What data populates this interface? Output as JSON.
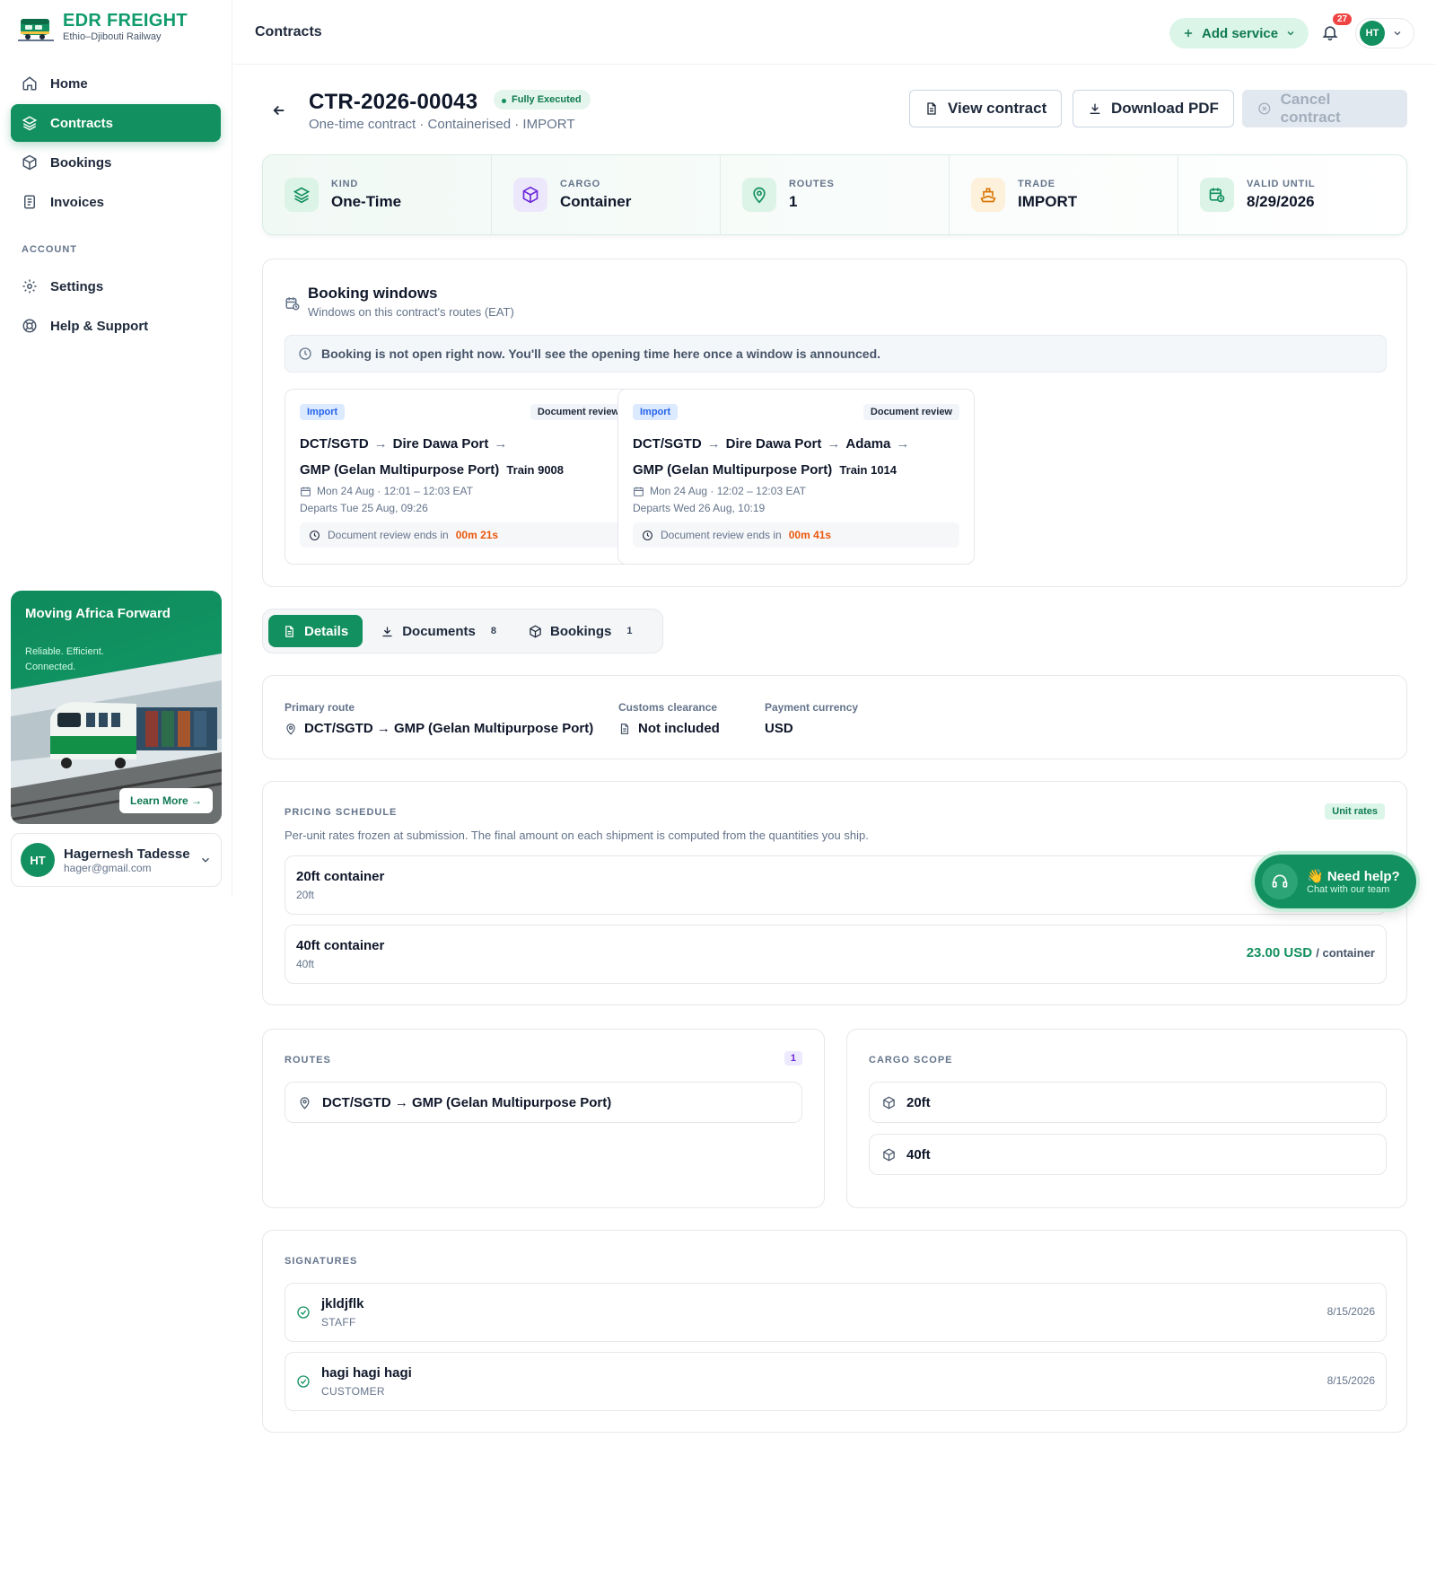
{
  "brand": {
    "title": "EDR FREIGHT",
    "subtitle": "Ethio–Djibouti Railway"
  },
  "sidebar": {
    "items": [
      {
        "label": "Home",
        "icon": "home-icon"
      },
      {
        "label": "Contracts",
        "icon": "layers-icon",
        "active": true
      },
      {
        "label": "Bookings",
        "icon": "package-icon"
      },
      {
        "label": "Invoices",
        "icon": "invoice-icon"
      }
    ],
    "account_label": "ACCOUNT",
    "account_items": [
      {
        "label": "Settings",
        "icon": "gear-icon"
      },
      {
        "label": "Help & Support",
        "icon": "lifebuoy-icon"
      }
    ],
    "promo": {
      "title": "Moving Africa Forward",
      "subtitle": "Reliable. Efficient. Connected.",
      "button": "Learn More →"
    },
    "user": {
      "initials": "HT",
      "name": "Hagernesh Tadesse",
      "email": "hager@gmail.com"
    }
  },
  "header": {
    "title": "Contracts",
    "add_service": "Add service",
    "notifications": "27",
    "user_initials": "HT"
  },
  "contract": {
    "id": "CTR-2026-00043",
    "status": "Fully Executed",
    "subtitle": "One-time contract · Containerised · IMPORT",
    "actions": {
      "view": "View contract",
      "download": "Download PDF",
      "cancel": "Cancel contract"
    }
  },
  "kpis": [
    {
      "label": "KIND",
      "value": "One-Time",
      "icon": "layers-icon",
      "color": "#13905f",
      "bg": "#dcf3e7"
    },
    {
      "label": "CARGO",
      "value": "Container",
      "icon": "box-icon",
      "color": "#6d28d9",
      "bg": "#ece7fb"
    },
    {
      "label": "ROUTES",
      "value": "1",
      "icon": "map-pin-icon",
      "color": "#13905f",
      "bg": "#dcf3e7"
    },
    {
      "label": "TRADE",
      "value": "IMPORT",
      "icon": "ship-icon",
      "color": "#d97706",
      "bg": "#fdf1dc"
    },
    {
      "label": "VALID UNTIL",
      "value": "8/29/2026",
      "icon": "calendar-clock-icon",
      "color": "#13905f",
      "bg": "#dcf3e7"
    }
  ],
  "booking_windows": {
    "title": "Booking windows",
    "subtitle": "Windows on this contract's routes (EAT)",
    "notice": "Booking is not open right now. You'll see the opening time here once a window is announced.",
    "windows": [
      {
        "tag": "Import",
        "stage": "Document review",
        "stops": [
          "DCT/SGTD",
          "Dire Dawa Port"
        ],
        "final": "GMP (Gelan Multipurpose Port)",
        "train": "Train 9008",
        "time": "Mon 24 Aug · 12:01 – 12:03 EAT",
        "departs": "Departs Tue 25 Aug, 09:26",
        "countdown_label": "Document review ends in",
        "countdown": "00m 21s"
      },
      {
        "tag": "Import",
        "stage": "Document review",
        "stops": [
          "DCT/SGTD",
          "Dire Dawa Port",
          "Adama"
        ],
        "final": "GMP (Gelan Multipurpose Port)",
        "train": "Train 1014",
        "time": "Mon 24 Aug · 12:02 – 12:03 EAT",
        "departs": "Departs Wed 26 Aug, 10:19",
        "countdown_label": "Document review ends in",
        "countdown": "00m 41s"
      }
    ]
  },
  "tabs": [
    {
      "label": "Details",
      "count": "",
      "icon": "file-icon",
      "active": true
    },
    {
      "label": "Documents",
      "count": "8",
      "icon": "download-icon"
    },
    {
      "label": "Bookings",
      "count": "1",
      "icon": "box-icon"
    }
  ],
  "details": {
    "primary_route_label": "Primary route",
    "primary_route": "DCT/SGTD → GMP (Gelan Multipurpose Port)",
    "customs_label": "Customs clearance",
    "customs": "Not included",
    "currency_label": "Payment currency",
    "currency": "USD"
  },
  "pricing": {
    "label": "PRICING SCHEDULE",
    "badge": "Unit rates",
    "subtitle": "Per-unit rates frozen at submission. The final amount on each shipment is computed from the quantities you ship.",
    "rows": [
      {
        "name": "20ft container",
        "size": "20ft",
        "amount": "",
        "unit": ""
      },
      {
        "name": "40ft container",
        "size": "40ft",
        "amount": "23.00 USD",
        "unit": "/ container"
      }
    ]
  },
  "help": {
    "title": "👋 Need help?",
    "subtitle": "Chat with our team"
  },
  "routes": {
    "label": "ROUTES",
    "count": "1",
    "items": [
      "DCT/SGTD → GMP (Gelan Multipurpose Port)"
    ]
  },
  "cargo": {
    "label": "CARGO SCOPE",
    "items": [
      "20ft",
      "40ft"
    ]
  },
  "signatures": {
    "label": "SIGNATURES",
    "items": [
      {
        "name": "jkldjflk",
        "role": "STAFF",
        "date": "8/15/2026"
      },
      {
        "name": "hagi hagi hagi",
        "role": "CUSTOMER",
        "date": "8/15/2026"
      }
    ]
  }
}
